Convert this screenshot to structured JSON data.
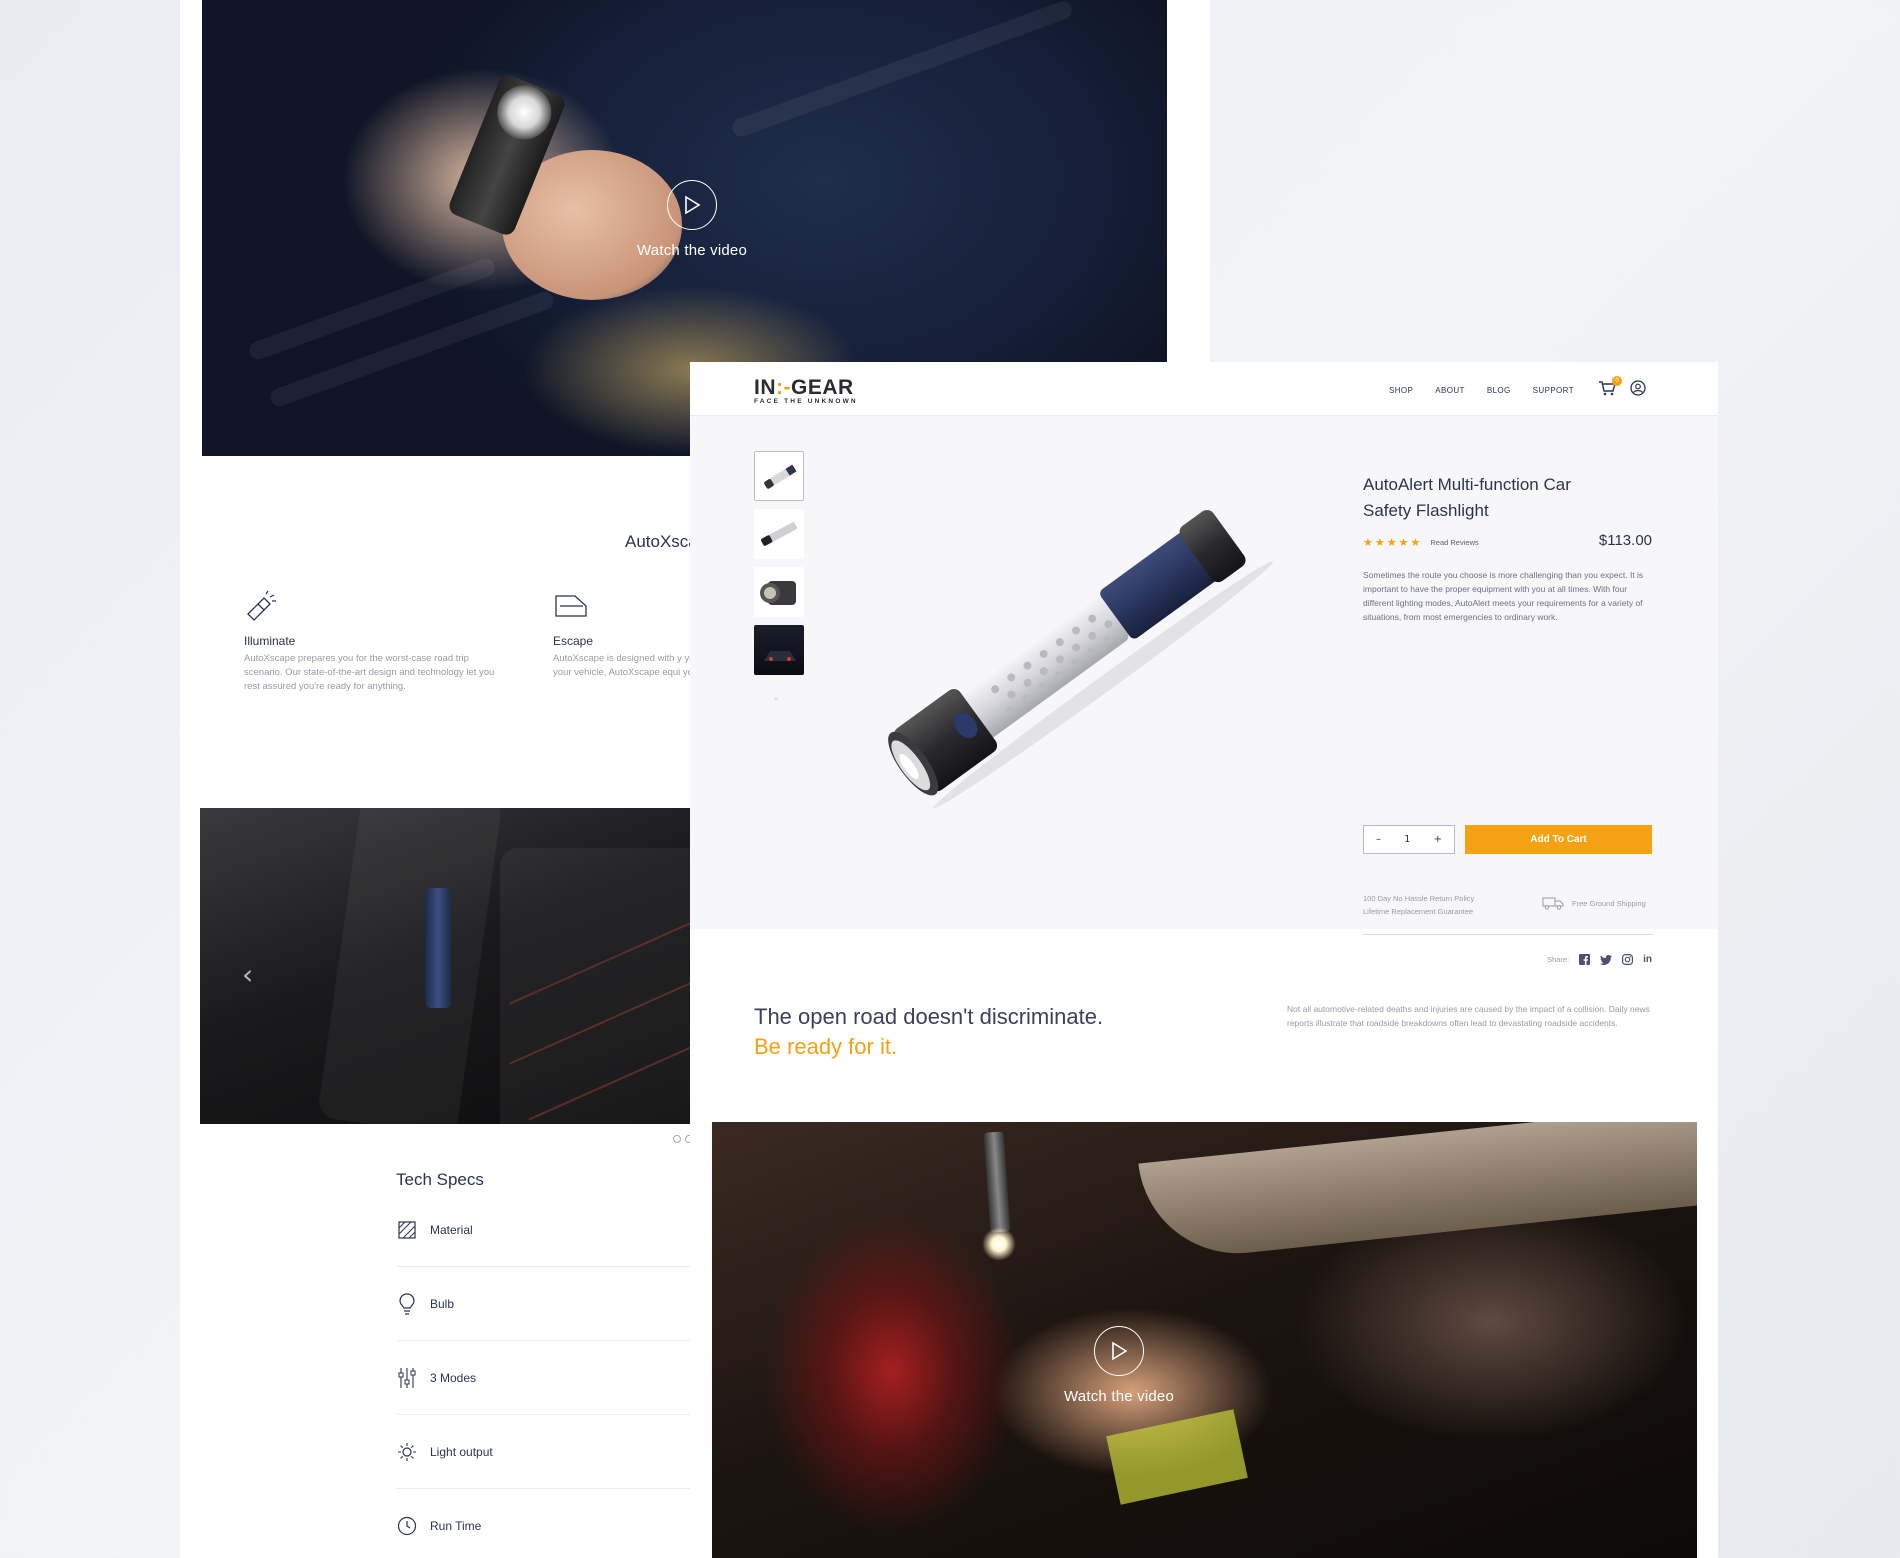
{
  "back_page": {
    "hero": {
      "play_label": "Watch the video"
    },
    "section_heading": "AutoXsca",
    "features": [
      {
        "icon": "flashlight-icon",
        "title": "Illuminate",
        "text": "AutoXscape prepares you for the worst-case road trip scenario. Our state-of-the-art design and technology let you rest assured you're ready for anything."
      },
      {
        "icon": "car-door-icon",
        "title": "Escape",
        "text": "AutoXscape is designed with y you're stranded on the side of your vehicle, AutoXscape equi your family, or others out of a"
      }
    ],
    "tech_specs": {
      "heading": "Tech Specs",
      "rows": [
        {
          "icon": "material-icon",
          "label": "Material"
        },
        {
          "icon": "bulb-icon",
          "label": "Bulb"
        },
        {
          "icon": "sliders-icon",
          "label": "3 Modes"
        },
        {
          "icon": "sun-icon",
          "label": "Light output"
        },
        {
          "icon": "clock-icon",
          "label": "Run Time"
        }
      ]
    }
  },
  "front_page": {
    "nav": {
      "logo_left": "IN",
      "logo_accent": ":-",
      "logo_right": "GEAR",
      "logo_tagline": "FACE THE UNKNOWN",
      "links": [
        "SHOP",
        "ABOUT",
        "BLOG",
        "SUPPORT"
      ],
      "cart_count": "0"
    },
    "product": {
      "title": "AutoAlert Multi-function Car Safety Flashlight",
      "rating": 5,
      "read_reviews": "Read Reviews",
      "price": "$113.00",
      "description": "Sometimes the route you choose is more challenging than you expect. It is important to have the proper equipment with you at all times. With four different lighting modes, AutoAlert meets your requirements for a variety of situations, from most emergencies to ordinary work.",
      "quantity": "1",
      "qty_minus": "–",
      "qty_plus": "+",
      "add_to_cart": "Add To Cart",
      "policy_1": "100 Day No Hassle Return Policy",
      "policy_2": "Lifetime Replacement Guarantee",
      "shipping": "Free Ground Shipping",
      "share_label": "Share:",
      "social": [
        "f",
        "t",
        "ig",
        "in"
      ]
    },
    "tagline": {
      "line1": "The open road doesn't discriminate.",
      "line2": "Be ready for it.",
      "side_note": "Not all automotive-related deaths and injuries are caused by the impact of a collision. Daily news reports illustrate that roadside breakdowns often lead to devastating roadside accidents."
    },
    "video": {
      "play_label": "Watch the video"
    }
  },
  "colors": {
    "accent": "#f4a113",
    "navy": "#2c3350"
  }
}
